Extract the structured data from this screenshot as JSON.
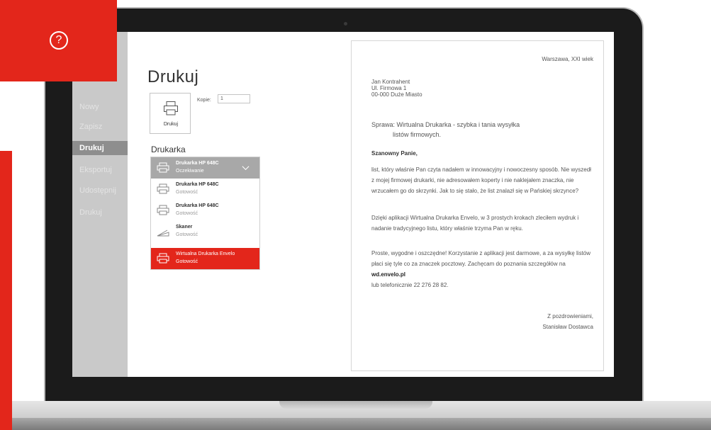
{
  "sidebar": {
    "items": [
      {
        "label": "Nowy"
      },
      {
        "label": "Zapisz"
      },
      {
        "label": "Drukuj",
        "active": true
      },
      {
        "label": "Eksportuj"
      },
      {
        "label": "Udostępnij"
      },
      {
        "label": "Drukuj"
      }
    ]
  },
  "print": {
    "title": "Drukuj",
    "button_label": "Drukuj",
    "copies_label": "Kopie:",
    "copies_value": "1",
    "printer_heading": "Drukarka"
  },
  "printers": [
    {
      "name": "Drukarka HP 648C",
      "status": "Oczekiwanie",
      "state": "selected"
    },
    {
      "name": "Drukarka HP 648C",
      "status": "Gotowość",
      "state": "normal"
    },
    {
      "name": "Drukarka HP 648C",
      "status": "Gotowość",
      "state": "normal"
    },
    {
      "name": "Skaner",
      "status": "Gotowość",
      "state": "normal"
    },
    {
      "name": "Wirtualna Drukarka Envelo",
      "status": "Gotowość",
      "state": "highlight"
    }
  ],
  "document": {
    "date": "Warszawa, XXI wiek",
    "address": [
      "Jan Kontrahent",
      "Ul. Firmowa 1",
      "00-000 Duże Miasto"
    ],
    "subject_line1": "Sprawa: Wirtualna Drukarka - szybka i tania wysyłka",
    "subject_line2": "listów firmowych.",
    "greeting": "Szanowny Panie,",
    "paragraph1": "list, który właśnie Pan czyta nadałem w innowacyjny i nowoczesny sposób. Nie wyszedł z mojej firmowej drukarki, nie adresowałem koperty i nie naklejałem znaczka, nie wrzucałem go do skrzynki. Jak to się stało, że list znalazł się w Pańskiej skrzynce?",
    "paragraph2": "Dzięki aplikacji Wirtualna Drukarka Envelo, w 3 prostych krokach zleciłem wydruk i nadanie tradycyjnego listu, który właśnie trzyma Pan w ręku.",
    "paragraph3_a": "Proste, wygodne i oszczędne! Korzystanie z aplikacji jest darmowe, a za wysyłkę listów płaci się tyle co za znaczek pocztowy. Zachęcam do poznania szczegółów na ",
    "paragraph3_link": "wd.envelo.pl",
    "paragraph3_b": "lub telefonicznie 22 276 28 82.",
    "closing": "Z pozdrowieniami,",
    "signature": "Stanisław Dostawca"
  },
  "colors": {
    "accent": "#e3261b",
    "sidebar": "#c9c9c9",
    "sidebar_active": "#8e8e8e",
    "selected_row": "#a8a8a8"
  },
  "icons": {
    "help": "question-circle-icon",
    "printer": "printer-icon",
    "scanner": "scanner-icon",
    "chevron": "chevron-down-icon"
  }
}
